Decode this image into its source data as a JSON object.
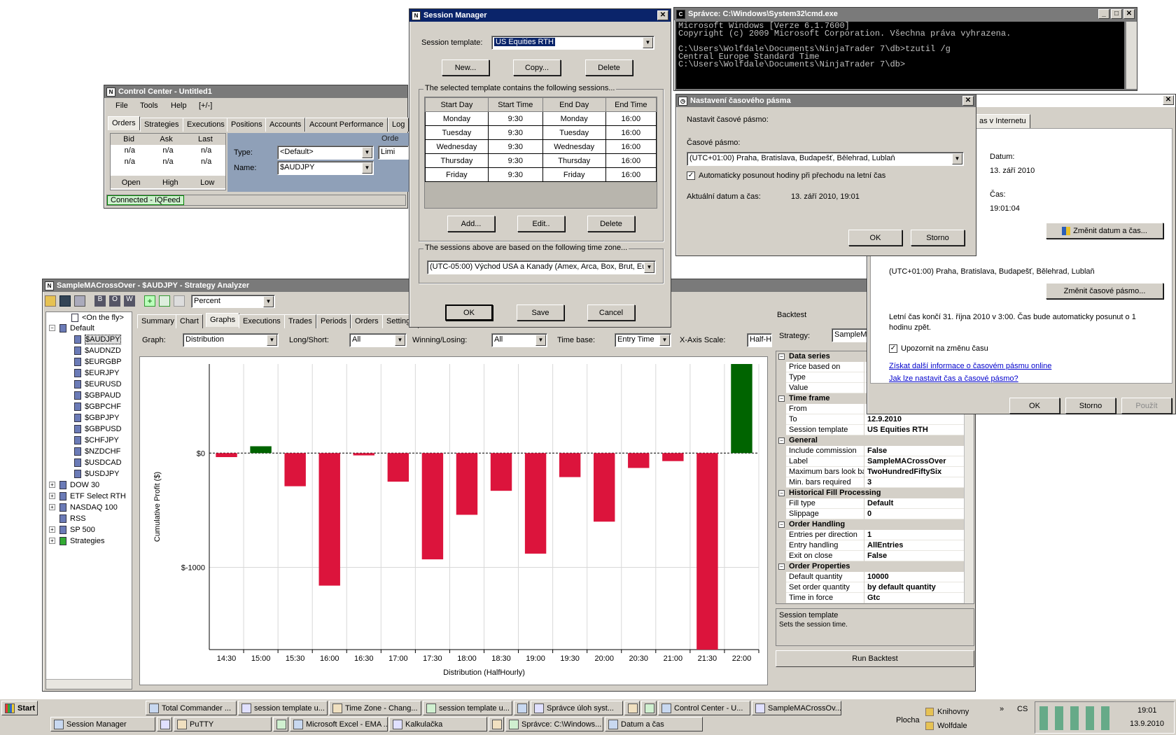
{
  "colors": {
    "title_active": "#0a246a",
    "title_inactive": "#7a7a7a",
    "bar_positive": "#006400",
    "bar_negative": "#dc143c",
    "connected": "#008000"
  },
  "control_center": {
    "title": "Control Center - Untitled1",
    "menu": [
      "File",
      "Tools",
      "Help",
      "[+/-]"
    ],
    "tabs": [
      "Orders",
      "Strategies",
      "Executions",
      "Positions",
      "Accounts",
      "Account Performance",
      "Log"
    ],
    "quote_headers": [
      "Bid",
      "Ask",
      "Last"
    ],
    "quote_row1": [
      "n/a",
      "n/a",
      "n/a"
    ],
    "quote_row2": [
      "n/a",
      "n/a",
      "n/a"
    ],
    "quote_footer": [
      "Open",
      "High",
      "Low"
    ],
    "type_label": "Type:",
    "type_value": "<Default>",
    "name_label": "Name:",
    "name_value": "$AUDJPY",
    "order_label": "Orde",
    "limit_value": "Limi",
    "status": "Connected - IQFeed"
  },
  "session_manager": {
    "title": "Session Manager",
    "template_label": "Session template:",
    "template_value": "US Equities RTH",
    "btn_new": "New...",
    "btn_copy": "Copy...",
    "btn_delete": "Delete",
    "sessions_group": "The selected template contains the following sessions...",
    "columns": [
      "Start Day",
      "Start Time",
      "End Day",
      "End Time"
    ],
    "rows": [
      [
        "Monday",
        "9:30",
        "Monday",
        "16:00"
      ],
      [
        "Tuesday",
        "9:30",
        "Tuesday",
        "16:00"
      ],
      [
        "Wednesday",
        "9:30",
        "Wednesday",
        "16:00"
      ],
      [
        "Thursday",
        "9:30",
        "Thursday",
        "16:00"
      ],
      [
        "Friday",
        "9:30",
        "Friday",
        "16:00"
      ]
    ],
    "btn_add": "Add...",
    "btn_edit": "Edit..",
    "btn_delete2": "Delete",
    "tz_group": "The sessions above are based on the following time zone...",
    "tz_value": "(UTC-05:00) Východ USA a Kanady (Amex, Arca, Box, Brut, Eure",
    "btn_ok": "OK",
    "btn_save": "Save",
    "btn_cancel": "Cancel"
  },
  "cmd": {
    "title": "Správce: C:\\Windows\\System32\\cmd.exe",
    "lines": [
      "Microsoft Windows [Verze 6.1.7600]",
      "Copyright (c) 2009 Microsoft Corporation. Všechna práva vyhrazena.",
      "",
      "C:\\Users\\Wolfdale\\Documents\\NinjaTrader 7\\db>tzutil /g",
      "Central Europe Standard Time",
      "C:\\Users\\Wolfdale\\Documents\\NinjaTrader 7\\db>"
    ]
  },
  "tz_dialog": {
    "title": "Nastavení časového pásma",
    "heading": "Nastavit časové pásmo:",
    "tz_label": "Časové pásmo:",
    "tz_value": "(UTC+01:00) Praha, Bratislava, Budapešť, Bělehrad, Lublaň",
    "auto_dst": "Automaticky posunout hodiny při přechodu na letní čas",
    "current_label": "Aktuální datum a čas:",
    "current_value": "13. září 2010, 19:01",
    "btn_ok": "OK",
    "btn_cancel": "Storno"
  },
  "datetime_dialog": {
    "tab_partial": "as v Internetu",
    "date_label": "Datum:",
    "date_value": "13. září 2010",
    "time_label": "Čas:",
    "time_value": "19:01:04",
    "btn_change_dt": "Změnit datum a čas...",
    "tz_value": "(UTC+01:00) Praha, Bratislava, Budapešť, Bělehrad, Lublaň",
    "btn_change_tz": "Změnit časové pásmo...",
    "dst_info": "Letní čas končí 31. října 2010 v 3:00. Čas bude automaticky posunut o 1 hodinu zpět.",
    "notify": "Upozornit na změnu času",
    "link1": "Získat další informace o časovém pásmu online",
    "link2": "Jak lze nastavit čas a časové pásmo?",
    "btn_ok": "OK",
    "btn_cancel": "Storno",
    "btn_apply": "Použít"
  },
  "strategy_analyzer": {
    "title": "SampleMACrossOver - $AUDJPY - Strategy Analyzer",
    "toolbar_select": "Percent",
    "tree_top": "<On the fly>",
    "tree_default": "Default",
    "instruments": [
      "$AUDJPY",
      "$AUDNZD",
      "$EURGBP",
      "$EURJPY",
      "$EURUSD",
      "$GBPAUD",
      "$GBPCHF",
      "$GBPJPY",
      "$GBPUSD",
      "$CHFJPY",
      "$NZDCHF",
      "$USDCAD",
      "$USDJPY"
    ],
    "lists": [
      "DOW 30",
      "ETF Select RTH",
      "NASDAQ 100",
      "RSS",
      "SP 500",
      "Strategies"
    ],
    "tabs": [
      "Summary",
      "Chart",
      "Graphs",
      "Executions",
      "Trades",
      "Periods",
      "Orders",
      "Settings"
    ],
    "graph_label": "Graph:",
    "graph_value": "Distribution",
    "longshort_label": "Long/Short:",
    "longshort_value": "All",
    "winlose_label": "Winning/Losing:",
    "winlose_value": "All",
    "timebase_label": "Time base:",
    "timebase_value": "Entry Time",
    "xscale_label": "X-Axis Scale:",
    "xscale_value": "Half-H",
    "backtest_label": "Backtest",
    "strategy_label": "Strategy:",
    "strategy_value": "SampleM",
    "prop_sections": [
      {
        "name": "Data series",
        "rows": [
          [
            "Price based on",
            ""
          ],
          [
            "Type",
            ""
          ],
          [
            "Value",
            ""
          ]
        ]
      },
      {
        "name": "Time frame",
        "rows": [
          [
            "From",
            ""
          ],
          [
            "To",
            "12.9.2010"
          ],
          [
            "Session template",
            "US Equities RTH"
          ]
        ]
      },
      {
        "name": "General",
        "rows": [
          [
            "Include commission",
            "False"
          ],
          [
            "Label",
            "SampleMACrossOver"
          ],
          [
            "Maximum bars look back",
            "TwoHundredFiftySix"
          ],
          [
            "Min. bars required",
            "3"
          ]
        ]
      },
      {
        "name": "Historical Fill Processing",
        "rows": [
          [
            "Fill type",
            "Default"
          ],
          [
            "Slippage",
            "0"
          ]
        ]
      },
      {
        "name": "Order Handling",
        "rows": [
          [
            "Entries per direction",
            "1"
          ],
          [
            "Entry handling",
            "AllEntries"
          ],
          [
            "Exit on close",
            "False"
          ]
        ]
      },
      {
        "name": "Order Properties",
        "rows": [
          [
            "Default quantity",
            "10000"
          ],
          [
            "Set order quantity",
            "by default quantity"
          ],
          [
            "Time in force",
            "Gtc"
          ]
        ]
      }
    ],
    "desc_title": "Session template",
    "desc_text": "Sets the session time.",
    "run_button": "Run Backtest"
  },
  "chart_data": {
    "type": "bar",
    "categories": [
      "14:30",
      "15:00",
      "15:30",
      "16:00",
      "16:30",
      "17:00",
      "17:30",
      "18:00",
      "18:30",
      "19:00",
      "19:30",
      "20:00",
      "20:30",
      "21:00",
      "21:30",
      "22:00"
    ],
    "values": [
      -35,
      60,
      -290,
      -1160,
      -20,
      -250,
      -930,
      -540,
      -330,
      -880,
      -210,
      -600,
      -130,
      -70,
      -1720,
      780
    ],
    "ylabel": "Cumulative Profit ($)",
    "xlabel": "Distribution (HalfHourly)",
    "yticks": [
      {
        "v": 0,
        "label": "$0"
      },
      {
        "v": -1000,
        "label": "$-1000"
      }
    ],
    "ylim": [
      -1720,
      780
    ],
    "grid": true
  },
  "taskbar": {
    "start": "Start",
    "row1": [
      "Total Commander ...",
      "session template u...",
      "Time Zone - Chang...",
      "session template u...",
      "",
      "Správce úloh syst...",
      "",
      "",
      "Control Center - U...",
      "SampleMACrossOv..."
    ],
    "row2": [
      "Session Manager",
      "",
      "PuTTY",
      "",
      "Microsoft Excel - EMA ...",
      "Kalkulačka",
      "",
      "Správce: C:\\Windows...",
      "Datum a čas"
    ],
    "plocha": "Plocha",
    "knihovny": "Knihovny",
    "wolfdale": "Wolfdale",
    "lang": "CS",
    "clock_time": "19:01",
    "clock_date": "13.9.2010"
  }
}
